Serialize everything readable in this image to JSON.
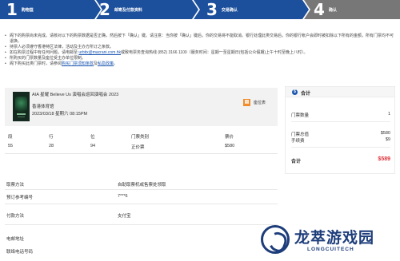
{
  "steps": [
    {
      "num": "1",
      "label": "购物篮"
    },
    {
      "num": "2",
      "label": "邮寄及付款资料"
    },
    {
      "num": "3",
      "label": "交易确认"
    },
    {
      "num": "4",
      "label": "确认"
    }
  ],
  "notes": [
    "阁下的购票尚未完成。请核对以下的购票数据是否正确，然后按下「确认」键。请注意：当你按「确认」键后，你的交易将不能取消。银行处理此类交易后，你的银行帐户会即时被扣除以下所有的金额，所有门票均不可退换。",
    "持票人必须遵守香港特区法律，活动及主办方所订之条款。",
    "如在购票过程中有任何问题，请电邮至 ",
    "所购买的门票数量及座位受主办单位限制。",
    "阁下购买此类门票时，请参阅"
  ],
  "notes_extra": {
    "email": "urbtix@macrani.com.hk",
    "email_tail": "或致电票务查询热线 (852) 3166 1100（服务时间：星期一至星期日(包括公众假期)上午十时至晚上八时）。",
    "terms_link": "购买门票须知条款",
    "terms_tail": "及",
    "privacy_link": "私隐政策",
    "period": "。"
  },
  "event": {
    "title": "AIA 星耀 Believe Us 演唱会巡回演唱会 2023",
    "venue": "香港体育馆",
    "date": "2023/03/18 星期六 08:15PM",
    "seatmap_label": "座位表"
  },
  "seat_table": {
    "headers": [
      "段",
      "行",
      "位",
      "门票类别",
      "票价"
    ],
    "row": [
      "55",
      "28",
      "94",
      "正价票",
      "$580"
    ]
  },
  "info": {
    "pickup_label": "取票方法",
    "pickup_value": "自助取票机或售票处领取",
    "ref_label": "预订参考编号",
    "ref_value": "7***6",
    "payment_label": "付款方法",
    "payment_value": "支付宝",
    "email_label": "电邮地址",
    "phone_label": "联络电话号码"
  },
  "summary": {
    "title": "合计",
    "qty_label": "门票数量",
    "qty_value": "1",
    "price_label": "门票总值",
    "price_value": "$580",
    "fee_label": "手续费",
    "fee_value": "$9",
    "total_label": "合计",
    "total_value": "$589"
  },
  "watermark": {
    "cn": "龙萃游戏园",
    "en": "LONGCUITECH"
  },
  "colors": {
    "step_active": "#1c4f9c",
    "step_last": "#777777",
    "accent": "#1a56b0",
    "total": "#e0303a",
    "seatmap": "#f08c2e"
  }
}
